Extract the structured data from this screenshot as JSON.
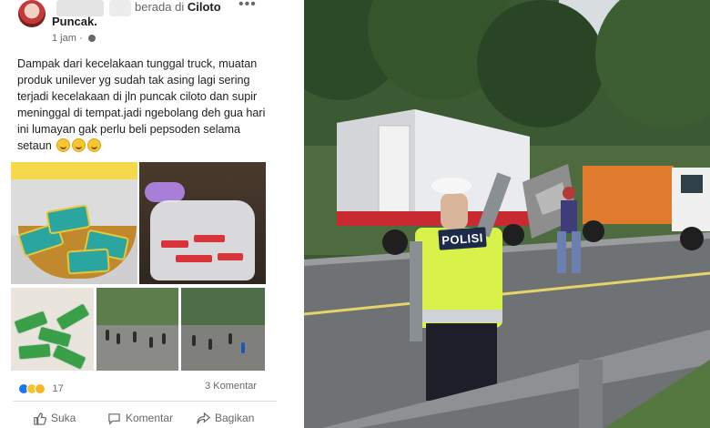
{
  "post": {
    "header_suffix": "berada di",
    "header_place": "Ciloto",
    "place_line": "Puncak.",
    "time": "1 jam",
    "time_separator": "·",
    "more_glyph": "•••",
    "body": "Dampak dari kecelakaan tunggal truck, muatan produk unilever  yg sudah tak asing lagi sering terjadi kecelakaan di jln puncak ciloto dan supir meninggal di tempat.jadi ngebolang deh gua hari ini lumayan gak perlu beli pepsoden selama setaun",
    "reaction_count": "17",
    "comments": "3 Komentar",
    "actions": {
      "like": "Suka",
      "comment": "Komentar",
      "share": "Bagikan"
    }
  },
  "photo": {
    "vest_label": "POLISI"
  },
  "icons": {
    "options": "more-options-icon",
    "privacy": "globe-icon",
    "like": "thumbs-up-icon",
    "comment": "comment-bubble-icon",
    "share": "share-arrow-icon"
  },
  "colors": {
    "text_primary": "#1c1e21",
    "text_secondary": "#65676b",
    "like_blue": "#1877f2",
    "vest_yellow": "#d9f24a"
  }
}
